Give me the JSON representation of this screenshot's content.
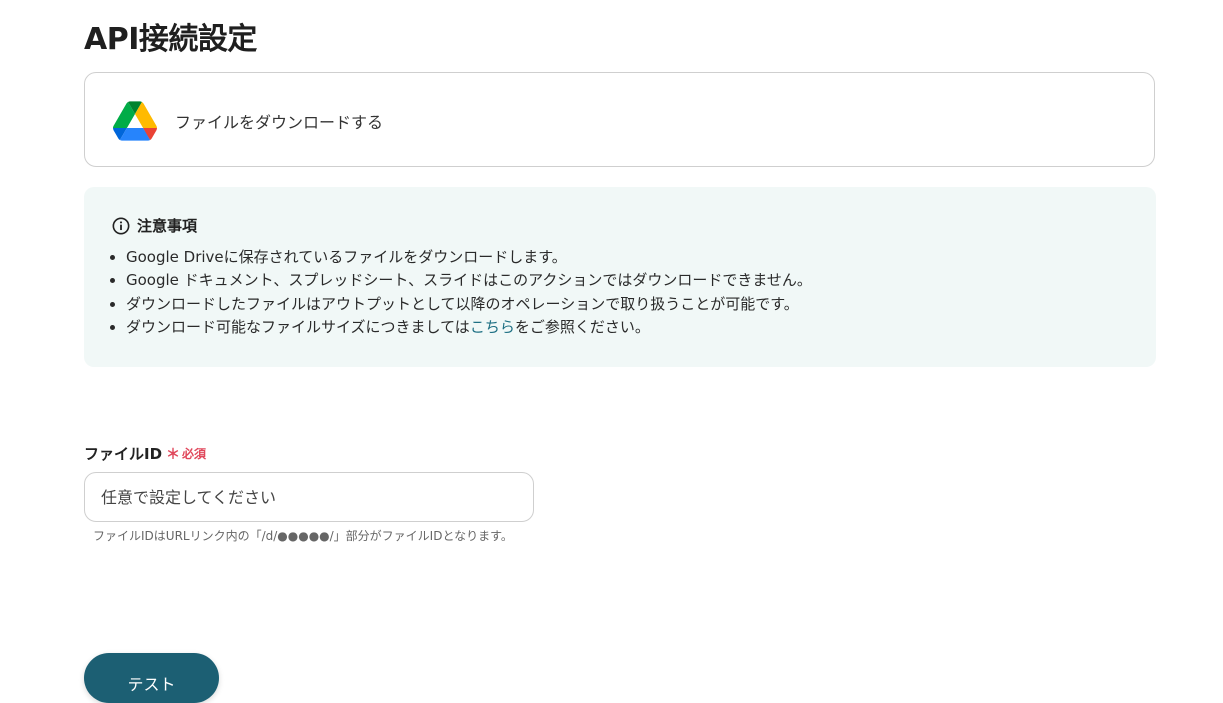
{
  "page": {
    "title": "API接続設定"
  },
  "action": {
    "label": "ファイルをダウンロードする",
    "icon": "google-drive-icon"
  },
  "notice": {
    "heading": "注意事項",
    "icon": "info-icon",
    "items": [
      "Google Driveに保存されているファイルをダウンロードします。",
      "Google ドキュメント、スプレッドシート、スライドはこのアクションではダウンロードできません。",
      "ダウンロードしたファイルはアウトプットとして以降のオペレーションで取り扱うことが可能です。"
    ],
    "last_item": {
      "before": "ダウンロード可能なファイルサイズにつきましては",
      "link": "こちら",
      "after": "をご参照ください。"
    },
    "link_color": "#1d6f83",
    "background": "#f1f8f7"
  },
  "file_id_field": {
    "label": "ファイルID",
    "required_mark": "＊",
    "required_text": "必須",
    "placeholder": "任意で設定してください",
    "value": "",
    "help": "ファイルIDはURLリンク内の「/d/●●●●●/」部分がファイルIDとなります。"
  },
  "buttons": {
    "test_label": "テスト"
  },
  "colors": {
    "accent": "#1c5f73",
    "required": "#e0475b"
  }
}
